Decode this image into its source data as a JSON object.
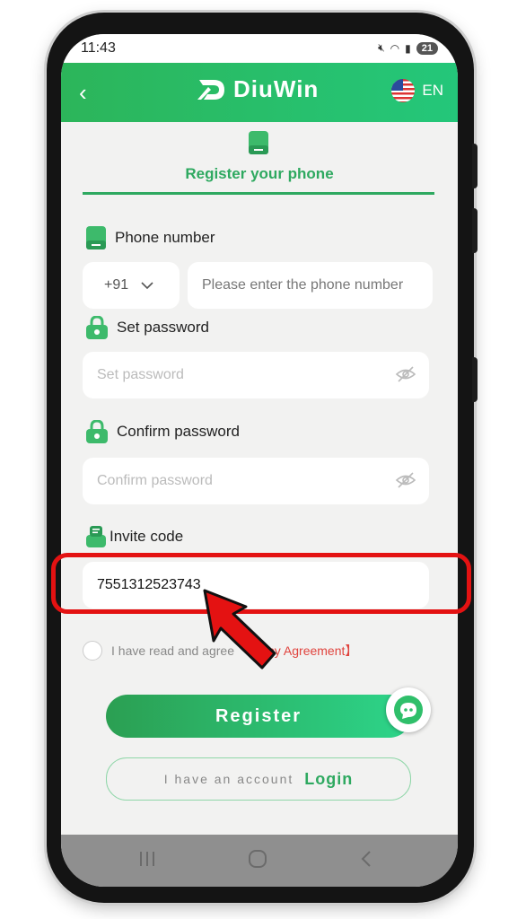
{
  "status": {
    "time": "11:43",
    "battery": "21"
  },
  "header": {
    "brand": "DiuWin",
    "language": "EN"
  },
  "tab": {
    "title": "Register your phone"
  },
  "form": {
    "phone_label": "Phone number",
    "country_code": "+91",
    "phone_placeholder": "Please enter the phone number",
    "password_label": "Set password",
    "password_placeholder": "Set password",
    "confirm_label": "Confirm password",
    "confirm_placeholder": "Confirm password",
    "invite_label": "Invite code",
    "invite_value": "7551312523743"
  },
  "agreement": {
    "text": "I have read and agree",
    "link_text": "acy Agreement】"
  },
  "buttons": {
    "register": "Register",
    "have_account": "I have an account",
    "login": "Login"
  },
  "colors": {
    "brand_green": "#2ea960",
    "highlight_red": "#e41212"
  },
  "icons": [
    "back-icon",
    "logo-icon",
    "us-flag-icon",
    "phone-icon",
    "lock-icon",
    "eye-off-icon",
    "invite-icon",
    "chat-icon",
    "recent-apps-icon",
    "home-icon",
    "back-nav-icon",
    "annotation-arrow-icon"
  ]
}
